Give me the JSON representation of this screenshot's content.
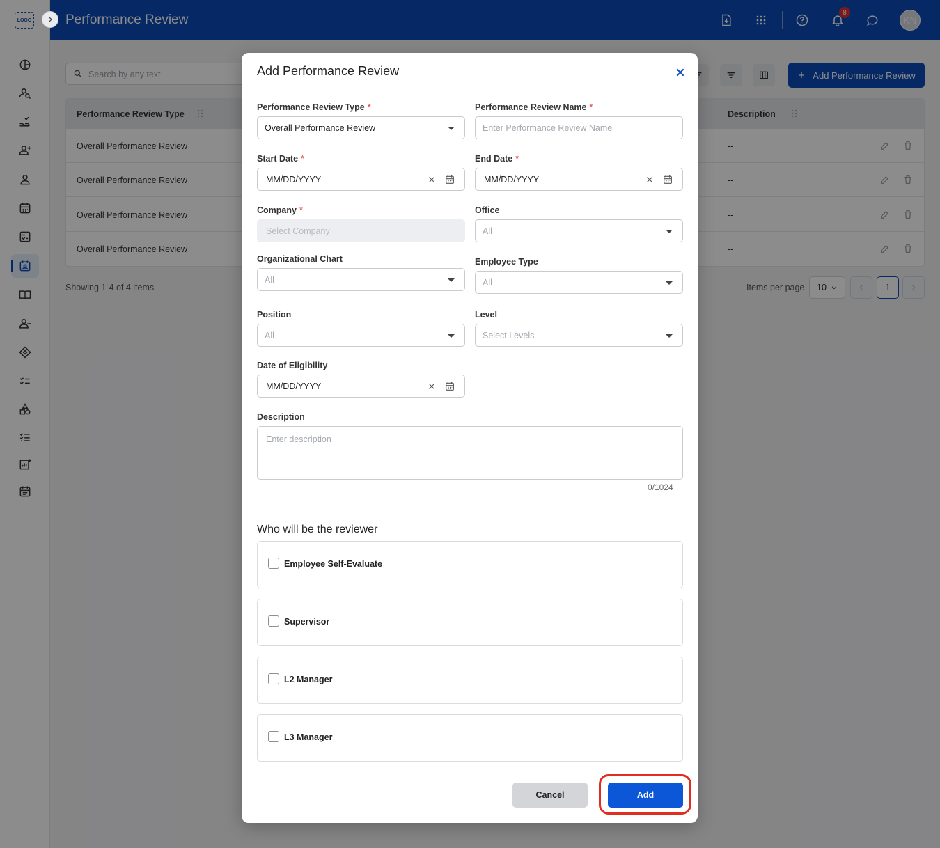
{
  "header": {
    "title": "Performance Review",
    "notification_count": "8",
    "avatar_initials": "KN",
    "logo_text": "LOGO"
  },
  "sidebar": {
    "items": [
      {
        "icon": "dashboard-icon"
      },
      {
        "icon": "people-search-icon"
      },
      {
        "icon": "hand-check-icon"
      },
      {
        "icon": "person-add-icon"
      },
      {
        "icon": "person-icon"
      },
      {
        "icon": "calendar-icon"
      },
      {
        "icon": "checklist-icon"
      },
      {
        "icon": "performance-review-icon",
        "active": true
      },
      {
        "icon": "book-icon"
      },
      {
        "icon": "person-remove-icon"
      },
      {
        "icon": "tag-icon"
      },
      {
        "icon": "tasks-icon"
      },
      {
        "icon": "shapes-icon"
      },
      {
        "icon": "list-icon"
      },
      {
        "icon": "analytics-icon"
      },
      {
        "icon": "event-icon"
      }
    ]
  },
  "main": {
    "search_placeholder": "Search by any text",
    "add_button_label": "Add Performance Review",
    "table": {
      "columns": [
        "Performance Review Type",
        "Description"
      ],
      "rows": [
        {
          "type": "Overall Performance Review",
          "description": "--"
        },
        {
          "type": "Overall Performance Review",
          "description": "--"
        },
        {
          "type": "Overall Performance Review",
          "description": "--"
        },
        {
          "type": "Overall Performance Review",
          "description": "--"
        }
      ]
    },
    "showing_text": "Showing 1-4 of 4 items",
    "items_per_page_label": "Items per page",
    "items_per_page_value": "10",
    "current_page": "1"
  },
  "modal": {
    "title": "Add Performance Review",
    "review_type_label": "Performance Review Type",
    "review_type_value": "Overall Performance Review",
    "review_name_label": "Performance Review Name",
    "review_name_placeholder": "Enter Performance Review Name",
    "start_date_label": "Start Date",
    "start_date_placeholder": "MM/DD/YYYY",
    "end_date_label": "End Date",
    "end_date_placeholder": "MM/DD/YYYY",
    "company_label": "Company",
    "company_placeholder": "Select Company",
    "office_label": "Office",
    "office_value": "All",
    "org_chart_label": "Organizational Chart",
    "org_chart_value": "All",
    "employee_type_label": "Employee Type",
    "employee_type_value": "All",
    "position_label": "Position",
    "position_value": "All",
    "level_label": "Level",
    "level_placeholder": "Select Levels",
    "eligibility_label": "Date of Eligibility",
    "eligibility_placeholder": "MM/DD/YYYY",
    "description_label": "Description",
    "description_placeholder": "Enter description",
    "description_counter": "0/1024",
    "reviewer_section_title": "Who will be the reviewer",
    "reviewers": [
      {
        "label": "Employee Self-Evaluate",
        "checked": false
      },
      {
        "label": "Supervisor",
        "checked": false
      },
      {
        "label": "L2 Manager",
        "checked": false
      },
      {
        "label": "L3 Manager",
        "checked": false
      }
    ],
    "cancel_label": "Cancel",
    "add_label": "Add",
    "required_mark": "*"
  },
  "colors": {
    "brand": "#0c4bb8",
    "primary_button": "#0c57d8",
    "required": "#e03131",
    "highlight": "#e02d1f"
  }
}
